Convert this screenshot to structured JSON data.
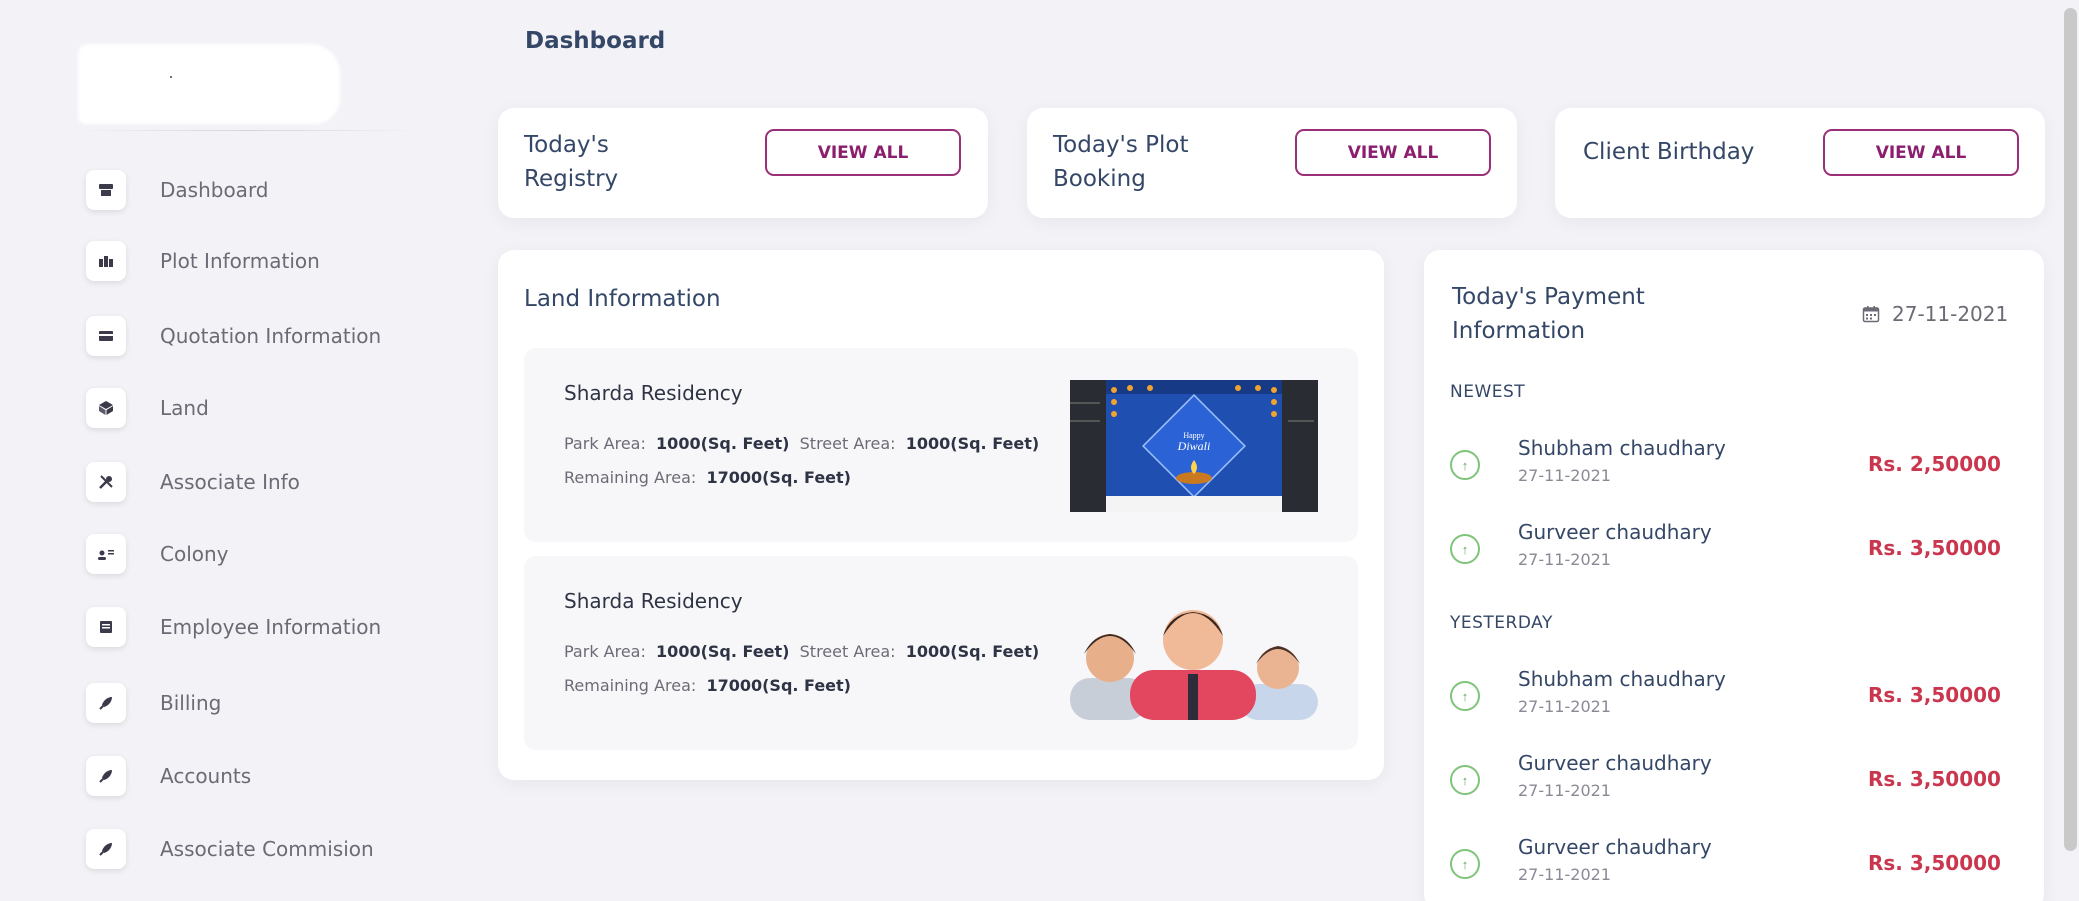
{
  "header": {
    "title": "Dashboard"
  },
  "sidebar": {
    "items": [
      {
        "label": "Dashboard",
        "icon": "store-icon"
      },
      {
        "label": "Plot Information",
        "icon": "building-icon"
      },
      {
        "label": "Quotation Information",
        "icon": "credit-card-icon"
      },
      {
        "label": "Land",
        "icon": "box-icon"
      },
      {
        "label": "Associate Info",
        "icon": "tools-icon"
      },
      {
        "label": "Colony",
        "icon": "users-icon"
      },
      {
        "label": "Employee Information",
        "icon": "document-icon"
      },
      {
        "label": "Billing",
        "icon": "rocket-icon"
      },
      {
        "label": "Accounts",
        "icon": "rocket-icon"
      },
      {
        "label": "Associate Commision",
        "icon": "rocket-icon"
      }
    ]
  },
  "summary_cards": [
    {
      "title_line1": "Today's",
      "title_line2": "Registry",
      "button": "VIEW ALL"
    },
    {
      "title_line1": "Today's Plot",
      "title_line2": "Booking",
      "button": "VIEW ALL"
    },
    {
      "title_line1": "Client Birthday",
      "title_line2": "",
      "button": "VIEW ALL"
    }
  ],
  "land": {
    "title": "Land Information",
    "items": [
      {
        "name": "Sharda Residency",
        "park_label": "Park Area:",
        "park_value": "1000(Sq. Feet)",
        "street_label": "Street Area:",
        "street_value": "1000(Sq. Feet)",
        "remaining_label": "Remaining Area:",
        "remaining_value": "17000(Sq. Feet)",
        "thumb_text_1": "Happy",
        "thumb_text_2": "Diwali"
      },
      {
        "name": "Sharda Residency",
        "park_label": "Park Area:",
        "park_value": "1000(Sq. Feet)",
        "street_label": "Street Area:",
        "street_value": "1000(Sq. Feet)",
        "remaining_label": "Remaining Area:",
        "remaining_value": "17000(Sq. Feet)"
      }
    ]
  },
  "payments": {
    "title_line1": "Today's Payment",
    "title_line2": "Information",
    "date": "27-11-2021",
    "newest_label": "NEWEST",
    "yesterday_label": "YESTERDAY",
    "newest": [
      {
        "name": "Shubham chaudhary",
        "date": "27-11-2021",
        "amount": "Rs. 2,50000"
      },
      {
        "name": "Gurveer chaudhary",
        "date": "27-11-2021",
        "amount": "Rs. 3,50000"
      }
    ],
    "yesterday": [
      {
        "name": "Shubham chaudhary",
        "date": "27-11-2021",
        "amount": "Rs. 3,50000"
      },
      {
        "name": "Gurveer chaudhary",
        "date": "27-11-2021",
        "amount": "Rs. 3,50000"
      },
      {
        "name": "Gurveer chaudhary",
        "date": "27-11-2021",
        "amount": "Rs. 3,50000"
      }
    ]
  },
  "colors": {
    "accent": "#8b1f6e",
    "amount": "#c9364e",
    "success": "#7fc47a",
    "background": "#f3f2f6"
  }
}
